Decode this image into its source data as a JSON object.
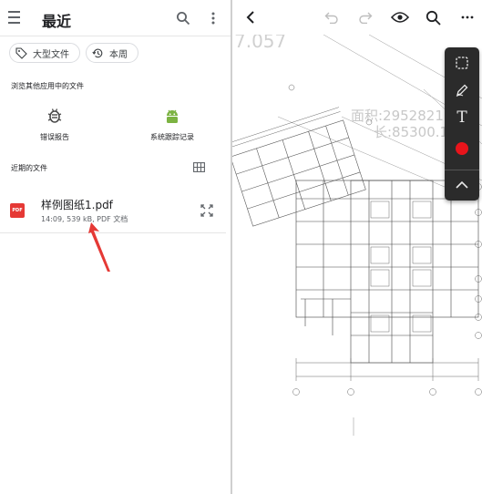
{
  "left_pane": {
    "title": "最近",
    "chips": [
      {
        "label": "大型文件",
        "icon": "tag-icon"
      },
      {
        "label": "本周",
        "icon": "history-icon"
      }
    ],
    "browse_section_label": "浏览其他应用中的文件",
    "apps": [
      {
        "label": "错误报告",
        "icon": "bug-icon",
        "color": "#4a4a4a"
      },
      {
        "label": "系统跟踪记录",
        "icon": "android-icon",
        "color": "#7cb342"
      }
    ],
    "recent_section_label": "近期的文件",
    "files": [
      {
        "name": "样例图纸1.pdf",
        "meta": "14:09, 539 kB, PDF 文档",
        "icon_text": "PDF",
        "icon_color": "#e53935"
      }
    ]
  },
  "viewer": {
    "drawing_annotations": [
      "面积:2952821",
      "长:85300.1",
      "7.057"
    ],
    "toolbox": {
      "tools": [
        "select-tool",
        "pen-tool",
        "text-tool",
        "color-picker",
        "collapse-tool"
      ],
      "active_color": "#e8141b",
      "text_tool_glyph": "T"
    }
  },
  "colors": {
    "accent_red": "#e53935",
    "toolbar_bg": "#2b2b2b"
  }
}
